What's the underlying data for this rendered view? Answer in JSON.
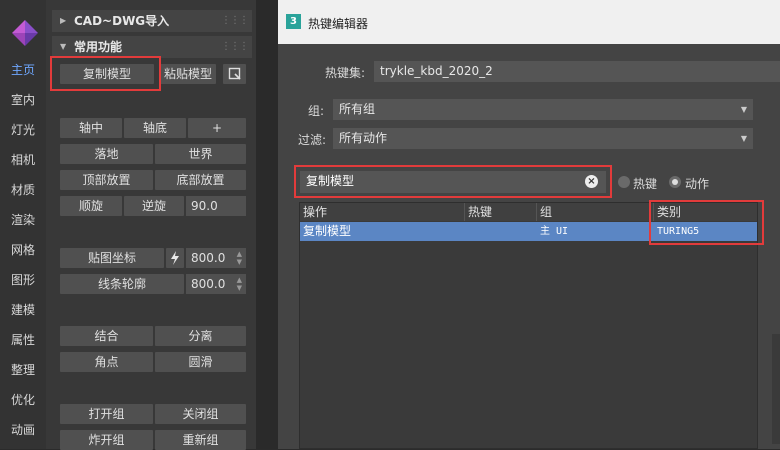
{
  "nav": {
    "items": [
      "主页",
      "室内",
      "灯光",
      "相机",
      "材质",
      "渲染",
      "网格",
      "图形",
      "建模",
      "属性",
      "整理",
      "优化",
      "动画"
    ],
    "active_index": 0
  },
  "panel": {
    "section1": "CAD~DWG导入",
    "section2": "常用功能",
    "copy_model": "复制模型",
    "paste_model": "粘贴模型",
    "axis_center": "轴中",
    "axis_bottom": "轴底",
    "plus": "+",
    "drop": "落地",
    "world": "世界",
    "top_place": "顶部放置",
    "bottom_place": "底部放置",
    "cw": "顺旋",
    "ccw": "逆旋",
    "rot_value": "90.0",
    "tex_coord": "贴图坐标",
    "tex_value": "800.0",
    "outline": "线条轮廓",
    "outline_value": "800.0",
    "combine": "结合",
    "separate": "分离",
    "corner": "角点",
    "smooth": "圆滑",
    "open_group": "打开组",
    "close_group": "关闭组",
    "explode_group": "炸开组",
    "regroup": "重新组"
  },
  "dialog": {
    "title": "热键编辑器",
    "icon_text": "3",
    "hotkey_set_label": "热键集:",
    "hotkey_set_value": "trykle_kbd_2020_2",
    "group_label": "组:",
    "group_value": "所有组",
    "filter_label": "过滤:",
    "filter_value": "所有动作",
    "search_value": "复制模型",
    "radio_hotkey": "热键",
    "radio_action": "动作",
    "radio_selected": "动作",
    "columns": [
      "操作",
      "热键",
      "组",
      "类别"
    ],
    "rows": [
      {
        "action": "复制模型",
        "hotkey": "",
        "group": "主 UI",
        "category": "TURING5"
      }
    ]
  }
}
